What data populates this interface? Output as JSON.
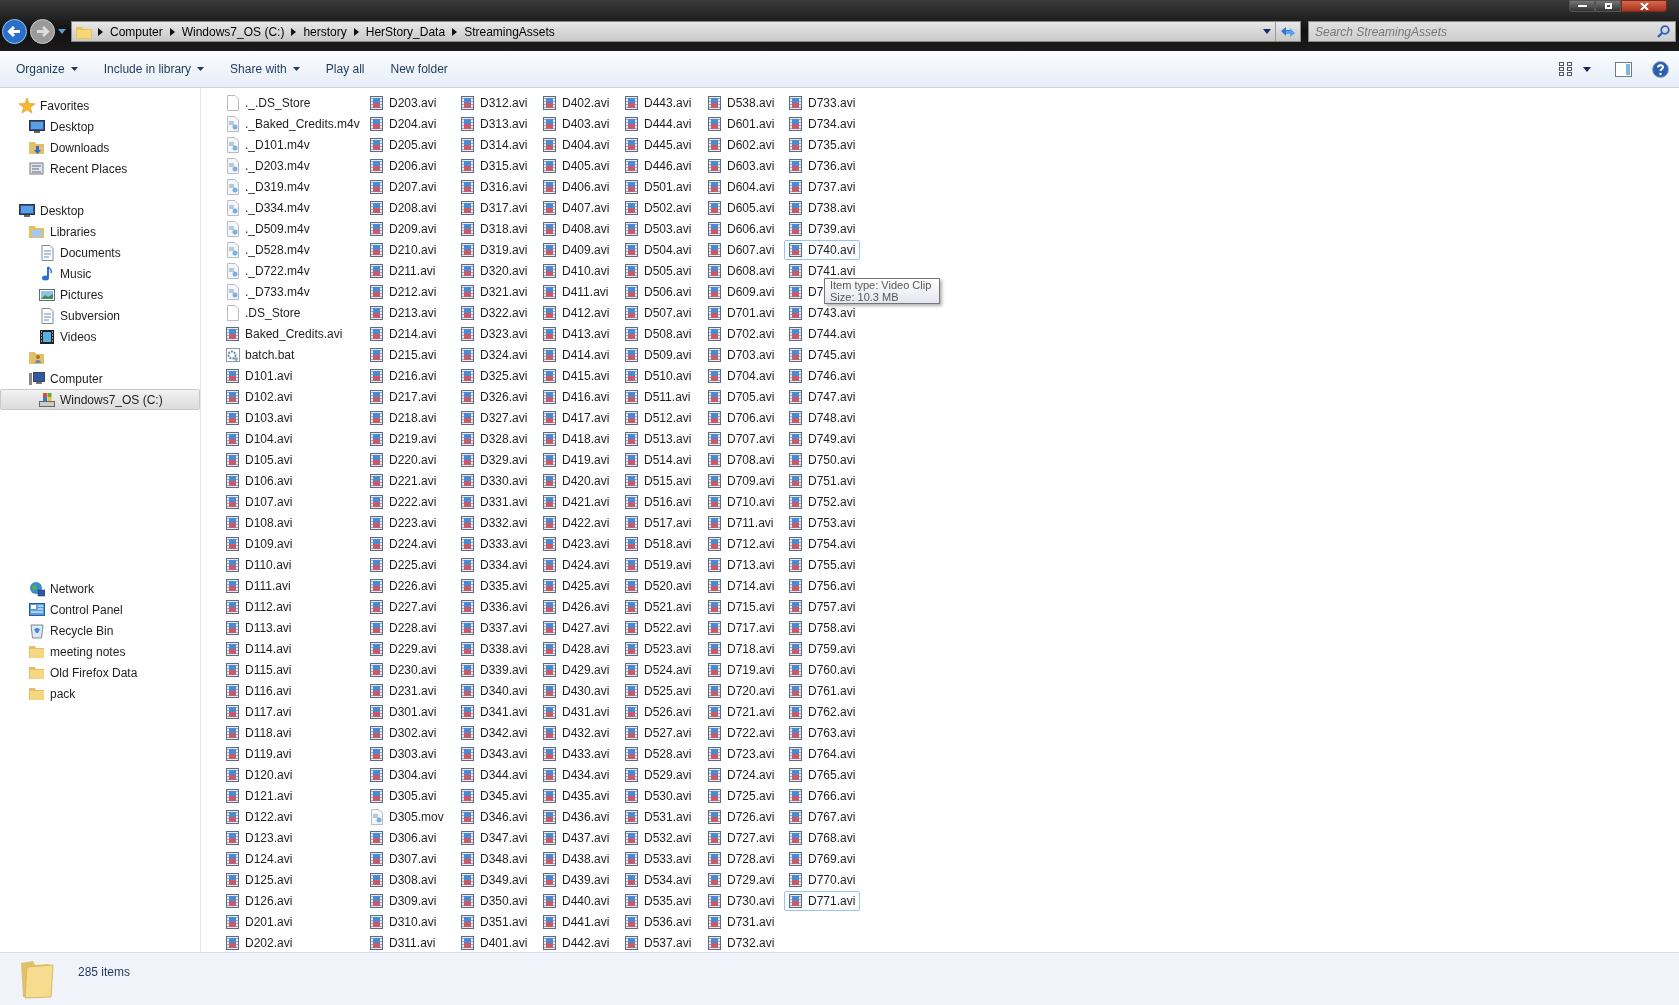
{
  "address_bar": {
    "crumbs": [
      "Computer",
      "Windows7_OS (C:)",
      "herstory",
      "HerStory_Data",
      "StreamingAssets"
    ]
  },
  "search": {
    "placeholder": "Search StreamingAssets"
  },
  "toolbar": {
    "commands": [
      {
        "label": "Organize",
        "dropdown": true
      },
      {
        "label": "Include in library",
        "dropdown": true
      },
      {
        "label": "Share with",
        "dropdown": true
      },
      {
        "label": "Play all",
        "dropdown": false
      },
      {
        "label": "New folder",
        "dropdown": false
      }
    ]
  },
  "sidebar": {
    "groups": [
      {
        "label": "Favorites",
        "kind": "star",
        "selected": false,
        "children": [
          {
            "label": "Desktop",
            "kind": "desktop",
            "selected": false
          },
          {
            "label": "Downloads",
            "kind": "downloads",
            "selected": false
          },
          {
            "label": "Recent Places",
            "kind": "recent",
            "selected": false
          }
        ]
      },
      {
        "label": "Desktop",
        "kind": "desktop",
        "selected": false,
        "children": [
          {
            "label": "Libraries",
            "kind": "libraries",
            "selected": false,
            "children": [
              {
                "label": "Documents",
                "kind": "document",
                "selected": false
              },
              {
                "label": "Music",
                "kind": "music",
                "selected": false
              },
              {
                "label": "Pictures",
                "kind": "pictures",
                "selected": false
              },
              {
                "label": "Subversion",
                "kind": "document",
                "selected": false
              },
              {
                "label": "Videos",
                "kind": "videos",
                "selected": false
              }
            ]
          },
          {
            "kind": "user-folder",
            "selected": false
          },
          {
            "label": "Computer",
            "kind": "computer",
            "selected": false,
            "children": [
              {
                "label": "Windows7_OS (C:)",
                "kind": "drive",
                "selected": true
              }
            ]
          },
          {
            "label": "Network",
            "kind": "network",
            "selected": false,
            "gap_before": true
          },
          {
            "label": "Control Panel",
            "kind": "control-panel",
            "selected": false
          },
          {
            "label": "Recycle Bin",
            "kind": "recycle-bin",
            "selected": false
          },
          {
            "label": "meeting notes",
            "kind": "folder",
            "selected": false
          },
          {
            "label": "Old Firefox Data",
            "kind": "folder",
            "selected": false
          },
          {
            "label": "pack",
            "kind": "folder",
            "selected": false
          }
        ]
      }
    ]
  },
  "files": [
    {
      "name": "._.DS_Store",
      "kind": "blank",
      "outlined": false
    },
    {
      "name": "._Baked_Credits.m4v",
      "kind": "m4v",
      "outlined": false
    },
    {
      "name": "._D101.m4v",
      "kind": "m4v",
      "outlined": false
    },
    {
      "name": "._D203.m4v",
      "kind": "m4v",
      "outlined": false
    },
    {
      "name": "._D319.m4v",
      "kind": "m4v",
      "outlined": false
    },
    {
      "name": "._D334.m4v",
      "kind": "m4v",
      "outlined": false
    },
    {
      "name": "._D509.m4v",
      "kind": "m4v",
      "outlined": false
    },
    {
      "name": "._D528.m4v",
      "kind": "m4v",
      "outlined": false
    },
    {
      "name": "._D722.m4v",
      "kind": "m4v",
      "outlined": false
    },
    {
      "name": "._D733.m4v",
      "kind": "m4v",
      "outlined": false
    },
    {
      "name": ".DS_Store",
      "kind": "blank",
      "outlined": false
    },
    {
      "name": "Baked_Credits.avi",
      "kind": "avi",
      "outlined": false
    },
    {
      "name": "batch.bat",
      "kind": "bat",
      "outlined": false
    },
    {
      "name": "D101.avi",
      "kind": "avi",
      "outlined": false
    },
    {
      "name": "D102.avi",
      "kind": "avi",
      "outlined": false
    },
    {
      "name": "D103.avi",
      "kind": "avi",
      "outlined": false
    },
    {
      "name": "D104.avi",
      "kind": "avi",
      "outlined": false
    },
    {
      "name": "D105.avi",
      "kind": "avi",
      "outlined": false
    },
    {
      "name": "D106.avi",
      "kind": "avi",
      "outlined": false
    },
    {
      "name": "D107.avi",
      "kind": "avi",
      "outlined": false
    },
    {
      "name": "D108.avi",
      "kind": "avi",
      "outlined": false
    },
    {
      "name": "D109.avi",
      "kind": "avi",
      "outlined": false
    },
    {
      "name": "D110.avi",
      "kind": "avi",
      "outlined": false
    },
    {
      "name": "D111.avi",
      "kind": "avi",
      "outlined": false
    },
    {
      "name": "D112.avi",
      "kind": "avi",
      "outlined": false
    },
    {
      "name": "D113.avi",
      "kind": "avi",
      "outlined": false
    },
    {
      "name": "D114.avi",
      "kind": "avi",
      "outlined": false
    },
    {
      "name": "D115.avi",
      "kind": "avi",
      "outlined": false
    },
    {
      "name": "D116.avi",
      "kind": "avi",
      "outlined": false
    },
    {
      "name": "D117.avi",
      "kind": "avi",
      "outlined": false
    },
    {
      "name": "D118.avi",
      "kind": "avi",
      "outlined": false
    },
    {
      "name": "D119.avi",
      "kind": "avi",
      "outlined": false
    },
    {
      "name": "D120.avi",
      "kind": "avi",
      "outlined": false
    },
    {
      "name": "D121.avi",
      "kind": "avi",
      "outlined": false
    },
    {
      "name": "D122.avi",
      "kind": "avi",
      "outlined": false
    },
    {
      "name": "D123.avi",
      "kind": "avi",
      "outlined": false
    },
    {
      "name": "D124.avi",
      "kind": "avi",
      "outlined": false
    },
    {
      "name": "D125.avi",
      "kind": "avi",
      "outlined": false
    },
    {
      "name": "D126.avi",
      "kind": "avi",
      "outlined": false
    },
    {
      "name": "D201.avi",
      "kind": "avi",
      "outlined": false
    },
    {
      "name": "D202.avi",
      "kind": "avi",
      "outlined": false
    },
    {
      "name": "D203.avi",
      "kind": "avi",
      "outlined": false
    },
    {
      "name": "D204.avi",
      "kind": "avi",
      "outlined": false
    },
    {
      "name": "D205.avi",
      "kind": "avi",
      "outlined": false
    },
    {
      "name": "D206.avi",
      "kind": "avi",
      "outlined": false
    },
    {
      "name": "D207.avi",
      "kind": "avi",
      "outlined": false
    },
    {
      "name": "D208.avi",
      "kind": "avi",
      "outlined": false
    },
    {
      "name": "D209.avi",
      "kind": "avi",
      "outlined": false
    },
    {
      "name": "D210.avi",
      "kind": "avi",
      "outlined": false
    },
    {
      "name": "D211.avi",
      "kind": "avi",
      "outlined": false
    },
    {
      "name": "D212.avi",
      "kind": "avi",
      "outlined": false
    },
    {
      "name": "D213.avi",
      "kind": "avi",
      "outlined": false
    },
    {
      "name": "D214.avi",
      "kind": "avi",
      "outlined": false
    },
    {
      "name": "D215.avi",
      "kind": "avi",
      "outlined": false
    },
    {
      "name": "D216.avi",
      "kind": "avi",
      "outlined": false
    },
    {
      "name": "D217.avi",
      "kind": "avi",
      "outlined": false
    },
    {
      "name": "D218.avi",
      "kind": "avi",
      "outlined": false
    },
    {
      "name": "D219.avi",
      "kind": "avi",
      "outlined": false
    },
    {
      "name": "D220.avi",
      "kind": "avi",
      "outlined": false
    },
    {
      "name": "D221.avi",
      "kind": "avi",
      "outlined": false
    },
    {
      "name": "D222.avi",
      "kind": "avi",
      "outlined": false
    },
    {
      "name": "D223.avi",
      "kind": "avi",
      "outlined": false
    },
    {
      "name": "D224.avi",
      "kind": "avi",
      "outlined": false
    },
    {
      "name": "D225.avi",
      "kind": "avi",
      "outlined": false
    },
    {
      "name": "D226.avi",
      "kind": "avi",
      "outlined": false
    },
    {
      "name": "D227.avi",
      "kind": "avi",
      "outlined": false
    },
    {
      "name": "D228.avi",
      "kind": "avi",
      "outlined": false
    },
    {
      "name": "D229.avi",
      "kind": "avi",
      "outlined": false
    },
    {
      "name": "D230.avi",
      "kind": "avi",
      "outlined": false
    },
    {
      "name": "D231.avi",
      "kind": "avi",
      "outlined": false
    },
    {
      "name": "D301.avi",
      "kind": "avi",
      "outlined": false
    },
    {
      "name": "D302.avi",
      "kind": "avi",
      "outlined": false
    },
    {
      "name": "D303.avi",
      "kind": "avi",
      "outlined": false
    },
    {
      "name": "D304.avi",
      "kind": "avi",
      "outlined": false
    },
    {
      "name": "D305.avi",
      "kind": "avi",
      "outlined": false
    },
    {
      "name": "D305.mov",
      "kind": "mov",
      "outlined": false
    },
    {
      "name": "D306.avi",
      "kind": "avi",
      "outlined": false
    },
    {
      "name": "D307.avi",
      "kind": "avi",
      "outlined": false
    },
    {
      "name": "D308.avi",
      "kind": "avi",
      "outlined": false
    },
    {
      "name": "D309.avi",
      "kind": "avi",
      "outlined": false
    },
    {
      "name": "D310.avi",
      "kind": "avi",
      "outlined": false
    },
    {
      "name": "D311.avi",
      "kind": "avi",
      "outlined": false
    },
    {
      "name": "D312.avi",
      "kind": "avi",
      "outlined": false
    },
    {
      "name": "D313.avi",
      "kind": "avi",
      "outlined": false
    },
    {
      "name": "D314.avi",
      "kind": "avi",
      "outlined": false
    },
    {
      "name": "D315.avi",
      "kind": "avi",
      "outlined": false
    },
    {
      "name": "D316.avi",
      "kind": "avi",
      "outlined": false
    },
    {
      "name": "D317.avi",
      "kind": "avi",
      "outlined": false
    },
    {
      "name": "D318.avi",
      "kind": "avi",
      "outlined": false
    },
    {
      "name": "D319.avi",
      "kind": "avi",
      "outlined": false
    },
    {
      "name": "D320.avi",
      "kind": "avi",
      "outlined": false
    },
    {
      "name": "D321.avi",
      "kind": "avi",
      "outlined": false
    },
    {
      "name": "D322.avi",
      "kind": "avi",
      "outlined": false
    },
    {
      "name": "D323.avi",
      "kind": "avi",
      "outlined": false
    },
    {
      "name": "D324.avi",
      "kind": "avi",
      "outlined": false
    },
    {
      "name": "D325.avi",
      "kind": "avi",
      "outlined": false
    },
    {
      "name": "D326.avi",
      "kind": "avi",
      "outlined": false
    },
    {
      "name": "D327.avi",
      "kind": "avi",
      "outlined": false
    },
    {
      "name": "D328.avi",
      "kind": "avi",
      "outlined": false
    },
    {
      "name": "D329.avi",
      "kind": "avi",
      "outlined": false
    },
    {
      "name": "D330.avi",
      "kind": "avi",
      "outlined": false
    },
    {
      "name": "D331.avi",
      "kind": "avi",
      "outlined": false
    },
    {
      "name": "D332.avi",
      "kind": "avi",
      "outlined": false
    },
    {
      "name": "D333.avi",
      "kind": "avi",
      "outlined": false
    },
    {
      "name": "D334.avi",
      "kind": "avi",
      "outlined": false
    },
    {
      "name": "D335.avi",
      "kind": "avi",
      "outlined": false
    },
    {
      "name": "D336.avi",
      "kind": "avi",
      "outlined": false
    },
    {
      "name": "D337.avi",
      "kind": "avi",
      "outlined": false
    },
    {
      "name": "D338.avi",
      "kind": "avi",
      "outlined": false
    },
    {
      "name": "D339.avi",
      "kind": "avi",
      "outlined": false
    },
    {
      "name": "D340.avi",
      "kind": "avi",
      "outlined": false
    },
    {
      "name": "D341.avi",
      "kind": "avi",
      "outlined": false
    },
    {
      "name": "D342.avi",
      "kind": "avi",
      "outlined": false
    },
    {
      "name": "D343.avi",
      "kind": "avi",
      "outlined": false
    },
    {
      "name": "D344.avi",
      "kind": "avi",
      "outlined": false
    },
    {
      "name": "D345.avi",
      "kind": "avi",
      "outlined": false
    },
    {
      "name": "D346.avi",
      "kind": "avi",
      "outlined": false
    },
    {
      "name": "D347.avi",
      "kind": "avi",
      "outlined": false
    },
    {
      "name": "D348.avi",
      "kind": "avi",
      "outlined": false
    },
    {
      "name": "D349.avi",
      "kind": "avi",
      "outlined": false
    },
    {
      "name": "D350.avi",
      "kind": "avi",
      "outlined": false
    },
    {
      "name": "D351.avi",
      "kind": "avi",
      "outlined": false
    },
    {
      "name": "D401.avi",
      "kind": "avi",
      "outlined": false
    },
    {
      "name": "D402.avi",
      "kind": "avi",
      "outlined": false
    },
    {
      "name": "D403.avi",
      "kind": "avi",
      "outlined": false
    },
    {
      "name": "D404.avi",
      "kind": "avi",
      "outlined": false
    },
    {
      "name": "D405.avi",
      "kind": "avi",
      "outlined": false
    },
    {
      "name": "D406.avi",
      "kind": "avi",
      "outlined": false
    },
    {
      "name": "D407.avi",
      "kind": "avi",
      "outlined": false
    },
    {
      "name": "D408.avi",
      "kind": "avi",
      "outlined": false
    },
    {
      "name": "D409.avi",
      "kind": "avi",
      "outlined": false
    },
    {
      "name": "D410.avi",
      "kind": "avi",
      "outlined": false
    },
    {
      "name": "D411.avi",
      "kind": "avi",
      "outlined": false
    },
    {
      "name": "D412.avi",
      "kind": "avi",
      "outlined": false
    },
    {
      "name": "D413.avi",
      "kind": "avi",
      "outlined": false
    },
    {
      "name": "D414.avi",
      "kind": "avi",
      "outlined": false
    },
    {
      "name": "D415.avi",
      "kind": "avi",
      "outlined": false
    },
    {
      "name": "D416.avi",
      "kind": "avi",
      "outlined": false
    },
    {
      "name": "D417.avi",
      "kind": "avi",
      "outlined": false
    },
    {
      "name": "D418.avi",
      "kind": "avi",
      "outlined": false
    },
    {
      "name": "D419.avi",
      "kind": "avi",
      "outlined": false
    },
    {
      "name": "D420.avi",
      "kind": "avi",
      "outlined": false
    },
    {
      "name": "D421.avi",
      "kind": "avi",
      "outlined": false
    },
    {
      "name": "D422.avi",
      "kind": "avi",
      "outlined": false
    },
    {
      "name": "D423.avi",
      "kind": "avi",
      "outlined": false
    },
    {
      "name": "D424.avi",
      "kind": "avi",
      "outlined": false
    },
    {
      "name": "D425.avi",
      "kind": "avi",
      "outlined": false
    },
    {
      "name": "D426.avi",
      "kind": "avi",
      "outlined": false
    },
    {
      "name": "D427.avi",
      "kind": "avi",
      "outlined": false
    },
    {
      "name": "D428.avi",
      "kind": "avi",
      "outlined": false
    },
    {
      "name": "D429.avi",
      "kind": "avi",
      "outlined": false
    },
    {
      "name": "D430.avi",
      "kind": "avi",
      "outlined": false
    },
    {
      "name": "D431.avi",
      "kind": "avi",
      "outlined": false
    },
    {
      "name": "D432.avi",
      "kind": "avi",
      "outlined": false
    },
    {
      "name": "D433.avi",
      "kind": "avi",
      "outlined": false
    },
    {
      "name": "D434.avi",
      "kind": "avi",
      "outlined": false
    },
    {
      "name": "D435.avi",
      "kind": "avi",
      "outlined": false
    },
    {
      "name": "D436.avi",
      "kind": "avi",
      "outlined": false
    },
    {
      "name": "D437.avi",
      "kind": "avi",
      "outlined": false
    },
    {
      "name": "D438.avi",
      "kind": "avi",
      "outlined": false
    },
    {
      "name": "D439.avi",
      "kind": "avi",
      "outlined": false
    },
    {
      "name": "D440.avi",
      "kind": "avi",
      "outlined": false
    },
    {
      "name": "D441.avi",
      "kind": "avi",
      "outlined": false
    },
    {
      "name": "D442.avi",
      "kind": "avi",
      "outlined": false
    },
    {
      "name": "D443.avi",
      "kind": "avi",
      "outlined": false
    },
    {
      "name": "D444.avi",
      "kind": "avi",
      "outlined": false
    },
    {
      "name": "D445.avi",
      "kind": "avi",
      "outlined": false
    },
    {
      "name": "D446.avi",
      "kind": "avi",
      "outlined": false
    },
    {
      "name": "D501.avi",
      "kind": "avi",
      "outlined": false
    },
    {
      "name": "D502.avi",
      "kind": "avi",
      "outlined": false
    },
    {
      "name": "D503.avi",
      "kind": "avi",
      "outlined": false
    },
    {
      "name": "D504.avi",
      "kind": "avi",
      "outlined": false
    },
    {
      "name": "D505.avi",
      "kind": "avi",
      "outlined": false
    },
    {
      "name": "D506.avi",
      "kind": "avi",
      "outlined": false
    },
    {
      "name": "D507.avi",
      "kind": "avi",
      "outlined": false
    },
    {
      "name": "D508.avi",
      "kind": "avi",
      "outlined": false
    },
    {
      "name": "D509.avi",
      "kind": "avi",
      "outlined": false
    },
    {
      "name": "D510.avi",
      "kind": "avi",
      "outlined": false
    },
    {
      "name": "D511.avi",
      "kind": "avi",
      "outlined": false
    },
    {
      "name": "D512.avi",
      "kind": "avi",
      "outlined": false
    },
    {
      "name": "D513.avi",
      "kind": "avi",
      "outlined": false
    },
    {
      "name": "D514.avi",
      "kind": "avi",
      "outlined": false
    },
    {
      "name": "D515.avi",
      "kind": "avi",
      "outlined": false
    },
    {
      "name": "D516.avi",
      "kind": "avi",
      "outlined": false
    },
    {
      "name": "D517.avi",
      "kind": "avi",
      "outlined": false
    },
    {
      "name": "D518.avi",
      "kind": "avi",
      "outlined": false
    },
    {
      "name": "D519.avi",
      "kind": "avi",
      "outlined": false
    },
    {
      "name": "D520.avi",
      "kind": "avi",
      "outlined": false
    },
    {
      "name": "D521.avi",
      "kind": "avi",
      "outlined": false
    },
    {
      "name": "D522.avi",
      "kind": "avi",
      "outlined": false
    },
    {
      "name": "D523.avi",
      "kind": "avi",
      "outlined": false
    },
    {
      "name": "D524.avi",
      "kind": "avi",
      "outlined": false
    },
    {
      "name": "D525.avi",
      "kind": "avi",
      "outlined": false
    },
    {
      "name": "D526.avi",
      "kind": "avi",
      "outlined": false
    },
    {
      "name": "D527.avi",
      "kind": "avi",
      "outlined": false
    },
    {
      "name": "D528.avi",
      "kind": "avi",
      "outlined": false
    },
    {
      "name": "D529.avi",
      "kind": "avi",
      "outlined": false
    },
    {
      "name": "D530.avi",
      "kind": "avi",
      "outlined": false
    },
    {
      "name": "D531.avi",
      "kind": "avi",
      "outlined": false
    },
    {
      "name": "D532.avi",
      "kind": "avi",
      "outlined": false
    },
    {
      "name": "D533.avi",
      "kind": "avi",
      "outlined": false
    },
    {
      "name": "D534.avi",
      "kind": "avi",
      "outlined": false
    },
    {
      "name": "D535.avi",
      "kind": "avi",
      "outlined": false
    },
    {
      "name": "D536.avi",
      "kind": "avi",
      "outlined": false
    },
    {
      "name": "D537.avi",
      "kind": "avi",
      "outlined": false
    },
    {
      "name": "D538.avi",
      "kind": "avi",
      "outlined": false
    },
    {
      "name": "D601.avi",
      "kind": "avi",
      "outlined": false
    },
    {
      "name": "D602.avi",
      "kind": "avi",
      "outlined": false
    },
    {
      "name": "D603.avi",
      "kind": "avi",
      "outlined": false
    },
    {
      "name": "D604.avi",
      "kind": "avi",
      "outlined": false
    },
    {
      "name": "D605.avi",
      "kind": "avi",
      "outlined": false
    },
    {
      "name": "D606.avi",
      "kind": "avi",
      "outlined": false
    },
    {
      "name": "D607.avi",
      "kind": "avi",
      "outlined": false
    },
    {
      "name": "D608.avi",
      "kind": "avi",
      "outlined": false
    },
    {
      "name": "D609.avi",
      "kind": "avi",
      "outlined": false
    },
    {
      "name": "D701.avi",
      "kind": "avi",
      "outlined": false
    },
    {
      "name": "D702.avi",
      "kind": "avi",
      "outlined": false
    },
    {
      "name": "D703.avi",
      "kind": "avi",
      "outlined": false
    },
    {
      "name": "D704.avi",
      "kind": "avi",
      "outlined": false
    },
    {
      "name": "D705.avi",
      "kind": "avi",
      "outlined": false
    },
    {
      "name": "D706.avi",
      "kind": "avi",
      "outlined": false
    },
    {
      "name": "D707.avi",
      "kind": "avi",
      "outlined": false
    },
    {
      "name": "D708.avi",
      "kind": "avi",
      "outlined": false
    },
    {
      "name": "D709.avi",
      "kind": "avi",
      "outlined": false
    },
    {
      "name": "D710.avi",
      "kind": "avi",
      "outlined": false
    },
    {
      "name": "D711.avi",
      "kind": "avi",
      "outlined": false
    },
    {
      "name": "D712.avi",
      "kind": "avi",
      "outlined": false
    },
    {
      "name": "D713.avi",
      "kind": "avi",
      "outlined": false
    },
    {
      "name": "D714.avi",
      "kind": "avi",
      "outlined": false
    },
    {
      "name": "D715.avi",
      "kind": "avi",
      "outlined": false
    },
    {
      "name": "D717.avi",
      "kind": "avi",
      "outlined": false
    },
    {
      "name": "D718.avi",
      "kind": "avi",
      "outlined": false
    },
    {
      "name": "D719.avi",
      "kind": "avi",
      "outlined": false
    },
    {
      "name": "D720.avi",
      "kind": "avi",
      "outlined": false
    },
    {
      "name": "D721.avi",
      "kind": "avi",
      "outlined": false
    },
    {
      "name": "D722.avi",
      "kind": "avi",
      "outlined": false
    },
    {
      "name": "D723.avi",
      "kind": "avi",
      "outlined": false
    },
    {
      "name": "D724.avi",
      "kind": "avi",
      "outlined": false
    },
    {
      "name": "D725.avi",
      "kind": "avi",
      "outlined": false
    },
    {
      "name": "D726.avi",
      "kind": "avi",
      "outlined": false
    },
    {
      "name": "D727.avi",
      "kind": "avi",
      "outlined": false
    },
    {
      "name": "D728.avi",
      "kind": "avi",
      "outlined": false
    },
    {
      "name": "D729.avi",
      "kind": "avi",
      "outlined": false
    },
    {
      "name": "D730.avi",
      "kind": "avi",
      "outlined": false
    },
    {
      "name": "D731.avi",
      "kind": "avi",
      "outlined": false
    },
    {
      "name": "D732.avi",
      "kind": "avi",
      "outlined": false
    },
    {
      "name": "D733.avi",
      "kind": "avi",
      "outlined": false
    },
    {
      "name": "D734.avi",
      "kind": "avi",
      "outlined": false
    },
    {
      "name": "D735.avi",
      "kind": "avi",
      "outlined": false
    },
    {
      "name": "D736.avi",
      "kind": "avi",
      "outlined": false
    },
    {
      "name": "D737.avi",
      "kind": "avi",
      "outlined": false
    },
    {
      "name": "D738.avi",
      "kind": "avi",
      "outlined": false
    },
    {
      "name": "D739.avi",
      "kind": "avi",
      "outlined": false
    },
    {
      "name": "D740.avi",
      "kind": "avi",
      "outlined": true
    },
    {
      "name": "D741.avi",
      "kind": "avi",
      "outlined": false
    },
    {
      "name": "D7",
      "kind": "avi",
      "outlined": false
    },
    {
      "name": "D743.avi",
      "kind": "avi",
      "outlined": false
    },
    {
      "name": "D744.avi",
      "kind": "avi",
      "outlined": false
    },
    {
      "name": "D745.avi",
      "kind": "avi",
      "outlined": false
    },
    {
      "name": "D746.avi",
      "kind": "avi",
      "outlined": false
    },
    {
      "name": "D747.avi",
      "kind": "avi",
      "outlined": false
    },
    {
      "name": "D748.avi",
      "kind": "avi",
      "outlined": false
    },
    {
      "name": "D749.avi",
      "kind": "avi",
      "outlined": false
    },
    {
      "name": "D750.avi",
      "kind": "avi",
      "outlined": false
    },
    {
      "name": "D751.avi",
      "kind": "avi",
      "outlined": false
    },
    {
      "name": "D752.avi",
      "kind": "avi",
      "outlined": false
    },
    {
      "name": "D753.avi",
      "kind": "avi",
      "outlined": false
    },
    {
      "name": "D754.avi",
      "kind": "avi",
      "outlined": false
    },
    {
      "name": "D755.avi",
      "kind": "avi",
      "outlined": false
    },
    {
      "name": "D756.avi",
      "kind": "avi",
      "outlined": false
    },
    {
      "name": "D757.avi",
      "kind": "avi",
      "outlined": false
    },
    {
      "name": "D758.avi",
      "kind": "avi",
      "outlined": false
    },
    {
      "name": "D759.avi",
      "kind": "avi",
      "outlined": false
    },
    {
      "name": "D760.avi",
      "kind": "avi",
      "outlined": false
    },
    {
      "name": "D761.avi",
      "kind": "avi",
      "outlined": false
    },
    {
      "name": "D762.avi",
      "kind": "avi",
      "outlined": false
    },
    {
      "name": "D763.avi",
      "kind": "avi",
      "outlined": false
    },
    {
      "name": "D764.avi",
      "kind": "avi",
      "outlined": false
    },
    {
      "name": "D765.avi",
      "kind": "avi",
      "outlined": false
    },
    {
      "name": "D766.avi",
      "kind": "avi",
      "outlined": false
    },
    {
      "name": "D767.avi",
      "kind": "avi",
      "outlined": false
    },
    {
      "name": "D768.avi",
      "kind": "avi",
      "outlined": false
    },
    {
      "name": "D769.avi",
      "kind": "avi",
      "outlined": false
    },
    {
      "name": "D770.avi",
      "kind": "avi",
      "outlined": false
    },
    {
      "name": "D771.avi",
      "kind": "avi",
      "outlined": true
    }
  ],
  "tooltip": {
    "lines": [
      "Item type: Video Clip",
      "Size: 10.3 MB"
    ]
  },
  "status_bar": {
    "text": "285 items"
  }
}
